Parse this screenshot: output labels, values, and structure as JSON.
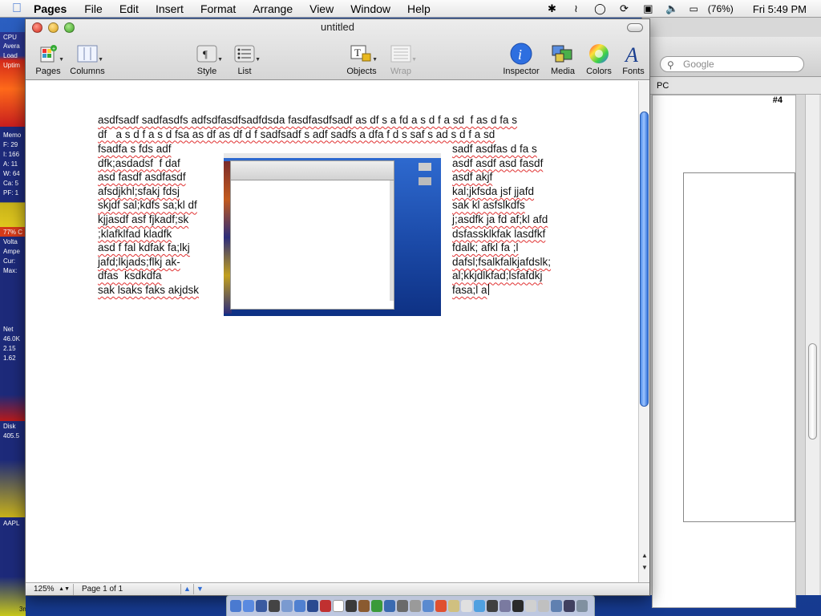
{
  "menubar": {
    "app_name": "Pages",
    "items": [
      "File",
      "Edit",
      "Insert",
      "Format",
      "Arrange",
      "View",
      "Window",
      "Help"
    ],
    "battery": "(76%)",
    "clock": "Fri 5:49 PM"
  },
  "window": {
    "title": "untitled",
    "toolbar": {
      "pages": "Pages",
      "columns": "Columns",
      "style": "Style",
      "list": "List",
      "objects": "Objects",
      "wrap": "Wrap",
      "inspector": "Inspector",
      "media": "Media",
      "colors": "Colors",
      "fonts": "Fonts"
    },
    "status": {
      "zoom": "125%",
      "page": "Page 1 of 1"
    }
  },
  "document": {
    "top_lines": [
      "asdfsadf sadfasdfs adfsdfasdfsadfdsda fasdfasdfsadf as df s a fd a s d f a sd  f as d fa s",
      "df   a s d f a s d fsa as df as df d f sadfsadf s adf sadfs a dfa f d s saf s ad s d f a sd"
    ],
    "left_lines": [
      "fsadfa s fds adf",
      "dfk;asdadsf  f daf",
      "asd fasdf asdfasdf",
      "afsdjkhl;sfakj fdsj",
      "skjdf sal;kdfs sa;kl df",
      "kjjasdf asf fjkadf;sk",
      ";klafklfad kladfk",
      "asd f fal kdfak fa;lkj",
      "jafd;lkjads;flkj ak-",
      "dfas  ksdkdfa",
      "sak lsaks faks akjdsk"
    ],
    "right_lines": [
      "sadf asdfas d fa s",
      "asdf asdf asd fasdf",
      "asdf akjf",
      "kal;jkfsda jsf jjafd",
      "sak kl asfslkdfs",
      "j;asdfk ja fd af;kl afd",
      "dsfassklkfak lasdfkf",
      "fdalk; afkl fa ;l",
      "dafsl;fsalkfalkjafdslk;",
      "al;kkjdlkfad;lsfafdkj",
      "fasa;l a"
    ]
  },
  "background_window": {
    "search_placeholder": "Google",
    "strip_text": "PC",
    "page_number": "#4"
  },
  "monitor": {
    "labels": [
      "CPU",
      "Avera",
      "Load",
      "Uptim",
      "Memo",
      "F: 29",
      "I: 166",
      "A: 11",
      "W: 64",
      "Ca: 5",
      "PF: 1",
      "77% C",
      "Volta",
      "Ampe",
      "Cur:",
      "Max:",
      "Net",
      "46.0K",
      "2.15",
      "1.62",
      "Disk",
      "405.5",
      "AAPL",
      "3m"
    ]
  }
}
